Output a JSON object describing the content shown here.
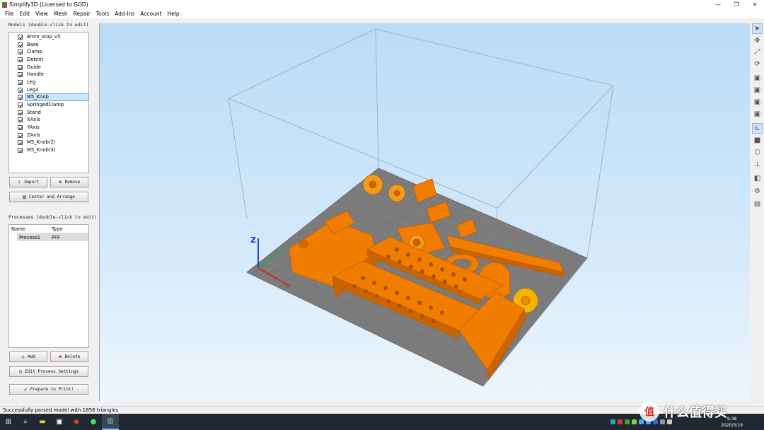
{
  "window": {
    "title": "Simplify3D (Licensed to GOD)",
    "controls": {
      "minimize": "—",
      "restore": "❐",
      "close": "✕"
    }
  },
  "menu": [
    "File",
    "Edit",
    "View",
    "Mesh",
    "Repair",
    "Tools",
    "Add-Ins",
    "Account",
    "Help"
  ],
  "models": {
    "title": "Models (double-click to edit)",
    "items": [
      {
        "label": "8mm_stop_v5",
        "checked": true
      },
      {
        "label": "Base",
        "checked": true
      },
      {
        "label": "Clamp",
        "checked": true
      },
      {
        "label": "Detent",
        "checked": true
      },
      {
        "label": "Guide",
        "checked": true
      },
      {
        "label": "Handle",
        "checked": true
      },
      {
        "label": "Leg",
        "checked": true
      },
      {
        "label": "Leg2",
        "checked": true
      },
      {
        "label": "M5_Knob",
        "checked": true,
        "selected": true
      },
      {
        "label": "SpringedClamp",
        "checked": true
      },
      {
        "label": "Stand",
        "checked": true
      },
      {
        "label": "XAxis",
        "checked": true
      },
      {
        "label": "YAxis",
        "checked": true
      },
      {
        "label": "ZAxis",
        "checked": true
      },
      {
        "label": "M5_Knob(2)",
        "checked": true
      },
      {
        "label": "M5_Knob(3)",
        "checked": true
      }
    ],
    "import_label": "Import",
    "remove_label": "Remove",
    "center_label": "Center and Arrange"
  },
  "processes": {
    "title": "Processes (double-click to edit)",
    "columns": [
      "Name",
      "Type"
    ],
    "rows": [
      {
        "name": "Process1",
        "type": "FFF"
      }
    ],
    "add_label": "Add",
    "delete_label": "Delete",
    "edit_label": "Edit Process Settings",
    "prepare_label": "Prepare to Print!"
  },
  "viewport": {
    "axis_label": "Z",
    "model_color": "#f07d00",
    "bed_color": "#7d7d7d"
  },
  "toolbar_icons": [
    "select-arrow-icon",
    "move-icon",
    "scale-icon",
    "rotate-icon",
    "view-iso-icon",
    "view-front-icon",
    "view-side-icon",
    "view-top-icon",
    "axes-icon",
    "solid-view-icon",
    "wireframe-icon",
    "cross-section-icon",
    "model-settings-icon",
    "gear-icon",
    "layers-icon"
  ],
  "status": "Successfully parsed model with 1858 triangles",
  "taskbar": {
    "clock_time": "9:38",
    "clock_date": "2020/3/19"
  },
  "watermark": {
    "badge": "值",
    "text": "什么值得买"
  }
}
